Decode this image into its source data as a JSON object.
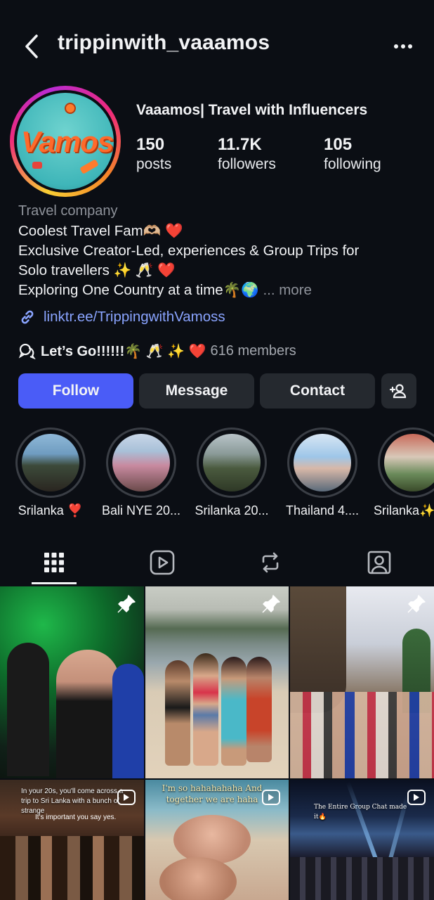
{
  "header": {
    "username": "trippinwith_vaaamos"
  },
  "profile": {
    "display_name": "Vaaamos| Travel with Influencers",
    "stats": [
      {
        "value": "150",
        "label": "posts"
      },
      {
        "value": "11.7K",
        "label": "followers"
      },
      {
        "value": "105",
        "label": "following"
      }
    ],
    "category": "Travel company",
    "bio_lines": [
      "Coolest Travel Fam🫶🏼 ❤️",
      "Exclusive Creator-Led, experiences & Group Trips for",
      "Solo travellers ✨ 🥂 ❤️",
      "Exploring One Country at a time🌴🌍"
    ],
    "bio_more": "... more",
    "link": "linktr.ee/TrippingwithVamoss",
    "channel": {
      "name": "Let’s Go!!!!!!🌴 🥂 ✨ ❤️",
      "members": "616 members"
    },
    "avatar_text": "Vamos"
  },
  "actions": {
    "follow": "Follow",
    "message": "Message",
    "contact": "Contact"
  },
  "highlights": [
    {
      "label": "Srilanka  ❣️"
    },
    {
      "label": "Bali NYE 20..."
    },
    {
      "label": "Srilanka 20..."
    },
    {
      "label": "Thailand 4...."
    },
    {
      "label": "Srilanka✨"
    }
  ],
  "tabs": [
    "grid",
    "reels",
    "reposts",
    "tagged"
  ],
  "posts": [
    {
      "type": "pinned",
      "caption": ""
    },
    {
      "type": "pinned",
      "caption": ""
    },
    {
      "type": "pinned",
      "caption": ""
    },
    {
      "type": "reel",
      "caption": "In your 20s, you'll come across a trip to Sri Lanka with a bunch of strange",
      "caption2": "It's important you say yes."
    },
    {
      "type": "reel",
      "caption": "I'm so hahahahaha And together we are haha"
    },
    {
      "type": "reel",
      "caption": "The Entire Group Chat made it🔥"
    }
  ],
  "colors": {
    "background": "#0b0e14",
    "follow_button": "#4a5cf7",
    "secondary_button": "#25292f",
    "link": "#8aa4ff",
    "muted_text": "#8e929a"
  }
}
